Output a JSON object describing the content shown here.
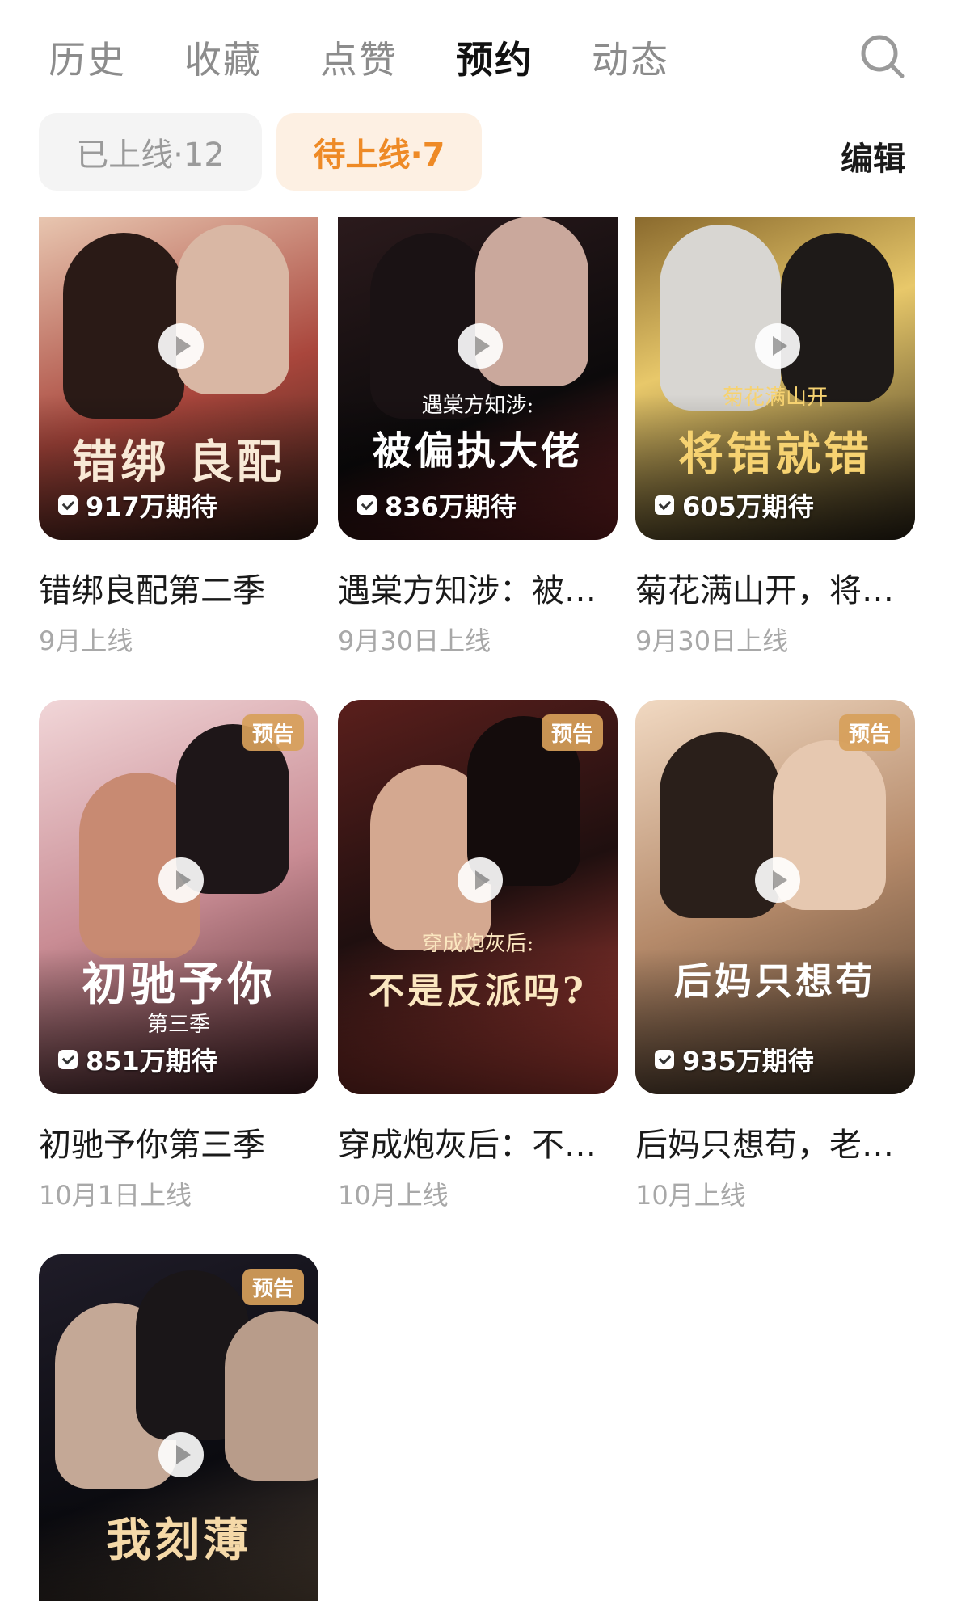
{
  "tabs": [
    {
      "label": "历史"
    },
    {
      "label": "收藏"
    },
    {
      "label": "点赞"
    },
    {
      "label": "预约",
      "active": true
    },
    {
      "label": "动态"
    }
  ],
  "search": {
    "icon": "search-icon"
  },
  "filters": {
    "online": "已上线·12",
    "upcoming": "待上线·7",
    "edit": "编辑"
  },
  "cards": [
    {
      "title": "错绑良配第二季",
      "date": "9月上线",
      "anticipation": "917万期待",
      "poster_title": "错绑 良配",
      "poster_sub": "",
      "badge": "",
      "colors": [
        "#3a1f18",
        "#a9463c",
        "#e8c6b0"
      ],
      "title_color": "#f8e9d6"
    },
    {
      "title": "遇棠方知涉：被…",
      "date": "9月30日上线",
      "anticipation": "836万期待",
      "poster_title": "被偏执大佬",
      "poster_sub": "遇棠方知涉:",
      "badge": "",
      "colors": [
        "#0c0a0b",
        "#2b1a1c",
        "#7a2426"
      ],
      "title_color": "#ffffff"
    },
    {
      "title": "菊花满山开，将…",
      "date": "9月30日上线",
      "anticipation": "605万期待",
      "poster_title": "将错就错",
      "poster_sub": "菊花满山开",
      "badge": "",
      "colors": [
        "#2e2618",
        "#8a6a2e",
        "#e8c86a"
      ],
      "title_color": "#f6d271"
    },
    {
      "title": "初驰予你第三季",
      "date": "10月1日上线",
      "anticipation": "851万期待",
      "poster_title": "初驰予你",
      "poster_sub": "第三季",
      "badge": "预告",
      "colors": [
        "#4a2227",
        "#c98c94",
        "#f1d6d8"
      ],
      "title_color": "#ffffff"
    },
    {
      "title": "穿成炮灰后：不…",
      "date": "10月上线",
      "anticipation": "",
      "poster_title": "不是反派吗?",
      "poster_sub": "穿成炮灰后:",
      "badge": "预告",
      "colors": [
        "#1f0f0f",
        "#5a1f1c",
        "#c1453c"
      ],
      "title_color": "#fbe7c0"
    },
    {
      "title": "后妈只想苟，老…",
      "date": "10月上线",
      "anticipation": "935万期待",
      "poster_title": "后妈只想苟",
      "poster_sub": "",
      "badge": "预告",
      "colors": [
        "#4c3a2a",
        "#b58a6a",
        "#f1d9c2"
      ],
      "title_color": "#ffffff"
    },
    {
      "title": "",
      "date": "",
      "anticipation": "",
      "poster_title": "我刻薄",
      "poster_sub": "",
      "badge": "预告",
      "colors": [
        "#0b0b10",
        "#1f1c28",
        "#5b4a3a"
      ],
      "title_color": "#f5d9a8"
    }
  ]
}
